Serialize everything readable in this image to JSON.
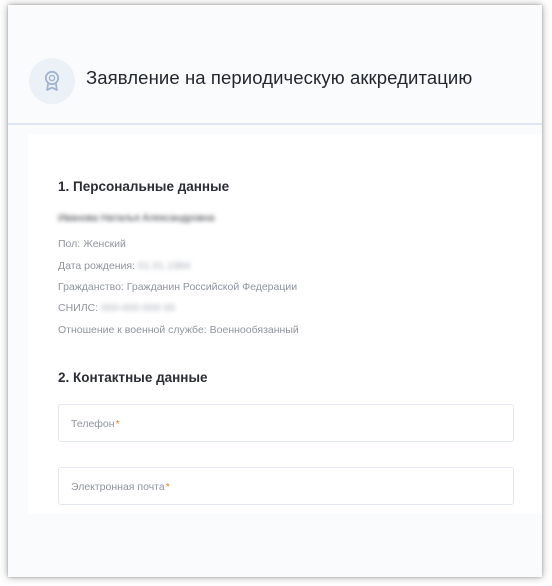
{
  "header": {
    "title": "Заявление на периодическую аккредитацию",
    "icon": "award-badge-icon"
  },
  "personal": {
    "section_title": "1. Персональные данные",
    "full_name": "Иванова Наталья Александровна",
    "gender_label": "Пол:",
    "gender_value": "Женский",
    "birthdate_label": "Дата рождения:",
    "birthdate_value": "01.01.1984",
    "citizenship_label": "Гражданство:",
    "citizenship_value": "Гражданин Российской Федерации",
    "snils_label": "СНИЛС:",
    "snils_value": "000-000-000 00",
    "military_label": "Отношение к военной службе:",
    "military_value": "Военнообязанный"
  },
  "contacts": {
    "section_title": "2. Контактные данные",
    "phone_label": "Телефон",
    "email_label": "Электронная почта",
    "required_mark": "*"
  },
  "colors": {
    "required": "#e0822c",
    "accent_icon": "#9fb4cf"
  }
}
